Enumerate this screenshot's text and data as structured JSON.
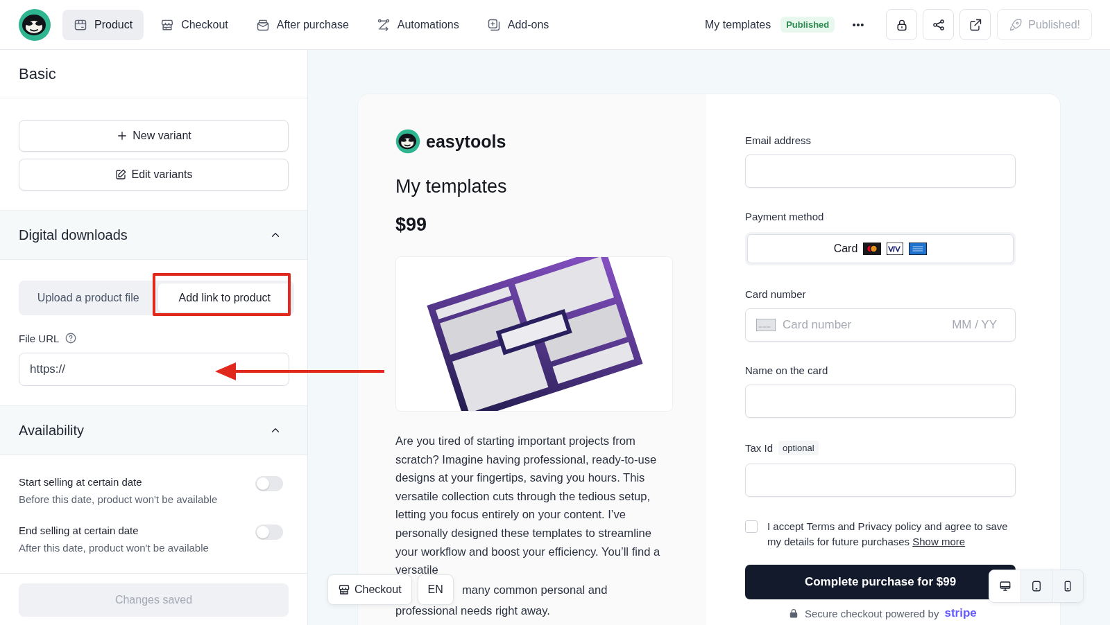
{
  "nav_tabs": [
    {
      "label": "Product",
      "selected": true
    },
    {
      "label": "Checkout",
      "selected": false
    },
    {
      "label": "After purchase",
      "selected": false
    },
    {
      "label": "Automations",
      "selected": false
    },
    {
      "label": "Add-ons",
      "selected": false
    }
  ],
  "product_name": "My templates",
  "status_badge": "Published",
  "publish_button": {
    "label": "Published!",
    "disabled": true
  },
  "sidebar": {
    "title": "Basic",
    "variant_buttons": [
      "New variant",
      "Edit variants"
    ],
    "digital_downloads": {
      "title": "Digital downloads",
      "expanded": true,
      "source_options": [
        {
          "label": "Upload a product file",
          "selected": false
        },
        {
          "label": "Add link to product",
          "selected": true
        }
      ],
      "file_url_label": "File URL",
      "file_url_value": "https://"
    },
    "availability": {
      "title": "Availability",
      "expanded": true,
      "toggles": [
        {
          "label": "Start selling at certain date",
          "hint": "Before this date, product won't be available",
          "on": false
        },
        {
          "label": "End selling at certain date",
          "hint": "After this date, product won't be available",
          "on": false
        }
      ]
    },
    "save_button": {
      "label": "Changes saved",
      "disabled": true
    }
  },
  "preview": {
    "brand": "easytools",
    "product_title": "My templates",
    "price": "$99",
    "image": {
      "kind": "picture"
    },
    "description": "Are you tired of starting important projects from scratch? Imagine having professional, ready-to-use designs at your fingertips, saving you hours. This versatile collection cuts through the tedious setup, letting you focus entirely on your content. I’ve personally designed these templates to streamline your workflow and boost your efficiency. You’ll find a versatile",
    "description_end": [
      "many common personal and",
      "professional needs right away."
    ],
    "form": {
      "email_label": "Email address",
      "payment_label": "Payment method",
      "payment_option": "Card",
      "card_label": "Card number",
      "card_placeholder": "Card number",
      "expiry_placeholder": "MM / YY",
      "name_label": "Name on the card",
      "tax_label": "Tax Id",
      "tax_optional": "optional",
      "terms": {
        "text": "I accept Terms and Privacy policy and agree to save my details for future purchases",
        "link": "Show more",
        "checked": false
      },
      "submit": "Complete purchase for $99",
      "secure_note": "Secure checkout powered by",
      "stripe": "stripe"
    }
  },
  "preview_controls": {
    "page_button": "Checkout",
    "language": "EN",
    "devices": [
      {
        "kind": "desktop",
        "selected": true
      },
      {
        "kind": "tablet",
        "selected": false
      },
      {
        "kind": "mobile",
        "selected": false
      }
    ]
  }
}
